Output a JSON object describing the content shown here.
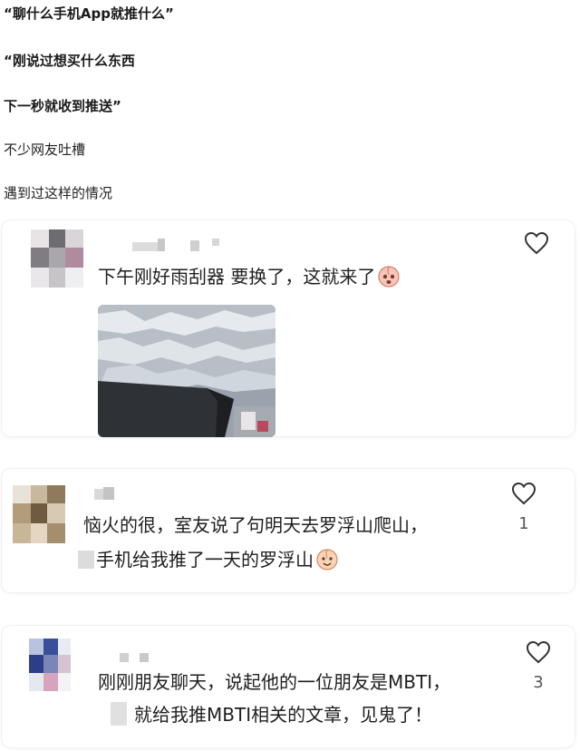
{
  "intro": {
    "line1": "“聊什么手机App就推什么”",
    "line2": "“刚说过想买什么东西",
    "line3": "下一秒就收到推送”",
    "line4": "不少网友吐槽",
    "line5": "遇到过这样的情况"
  },
  "comments": [
    {
      "text": "下午刚好雨刮器 要换了，这就来了",
      "like_count": "",
      "emoji": "peach-face-emoji"
    },
    {
      "line1": "恼火的很，室友说了句明天去罗浮山爬山，",
      "line2": "手机给我推了一天的罗浮山",
      "like_count": "1",
      "emoji": "peach-face-emoji"
    },
    {
      "line1": "刚刚朋友聊天，说起他的一位朋友是MBTI，",
      "line2": "就给我推MBTI相关的文章，见鬼了！",
      "like_count": "3"
    }
  ],
  "icons": {
    "like": "heart-outline-icon"
  },
  "colors": {
    "text": "#1f1f1f",
    "card_border": "#f0f0f0",
    "icon": "#333333"
  }
}
